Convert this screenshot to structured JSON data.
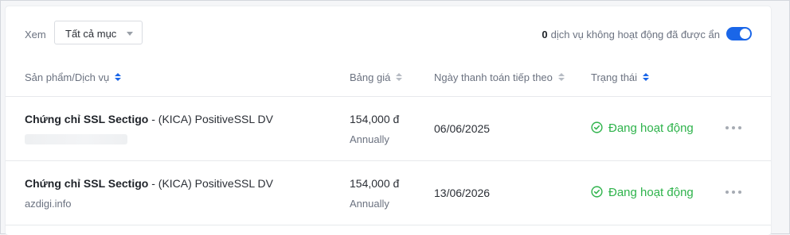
{
  "toolbar": {
    "view_label": "Xem",
    "view_select": "Tất cả mục",
    "hidden_count": "0",
    "hidden_text": "dịch vụ không hoạt động đã được ẩn",
    "toggle_on": true
  },
  "table": {
    "headers": {
      "product": "Sản phẩm/Dịch vụ",
      "price": "Bảng giá",
      "next_due": "Ngày thanh toán tiếp theo",
      "status": "Trạng thái"
    },
    "rows": [
      {
        "product_bold": "Chứng chỉ SSL Sectigo",
        "product_rest": " - (KICA) PositiveSSL DV",
        "domain": "",
        "price": "154,000 đ",
        "cycle": "Annually",
        "next_due": "06/06/2025",
        "status": "Đang hoạt động"
      },
      {
        "product_bold": "Chứng chỉ SSL Sectigo",
        "product_rest": " - (KICA) PositiveSSL DV",
        "domain": "azdigi.info",
        "price": "154,000 đ",
        "cycle": "Annually",
        "next_due": "13/06/2026",
        "status": "Đang hoạt động"
      }
    ]
  },
  "colors": {
    "accent": "#1a66e8",
    "status_active": "#2eb34b"
  },
  "icons": {
    "status": "check-circle-icon",
    "row_menu": "more-horizontal-icon",
    "select": "caret-down-icon",
    "sort": "sort-icon"
  }
}
